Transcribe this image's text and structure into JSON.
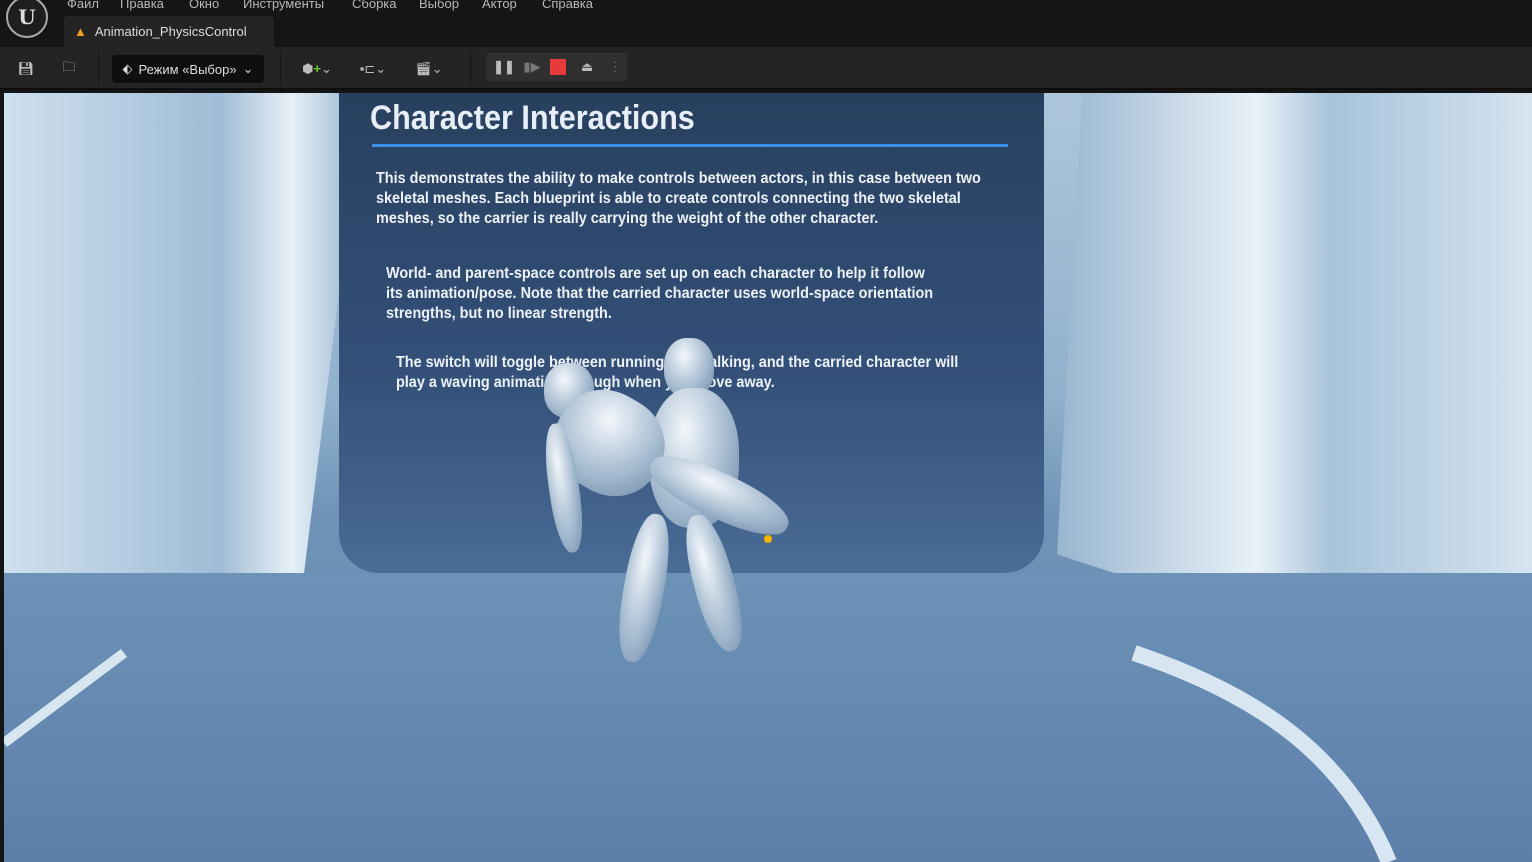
{
  "menu": [
    "Файл",
    "Правка",
    "Окно",
    "Инструменты",
    "Сборка",
    "Выбор",
    "Актор",
    "Справка"
  ],
  "logo": "U",
  "tab": {
    "title": "Animation_PhysicsControl"
  },
  "toolbar": {
    "mode_label": "Режим «Выбор»"
  },
  "panel": {
    "title": "Character Interactions",
    "p1": [
      "This demonstrates the ability to make controls between actors, in this case between two",
      "skeletal meshes. Each blueprint is able to create controls connecting the two skeletal",
      "meshes, so the carrier is really carrying the weight of the other character."
    ],
    "p2": [
      "World- and parent-space controls are set up on each character to help it follow",
      "its animation/pose. Note that the carried character uses world-space orientation",
      "strengths, but no linear strength."
    ],
    "p3": [
      "The switch will toggle between running and walking, and the carried character will",
      "play a waving animation through when you move away."
    ]
  },
  "colors": {
    "accent": "#3d8fe8",
    "stop": "#e83a3a"
  }
}
